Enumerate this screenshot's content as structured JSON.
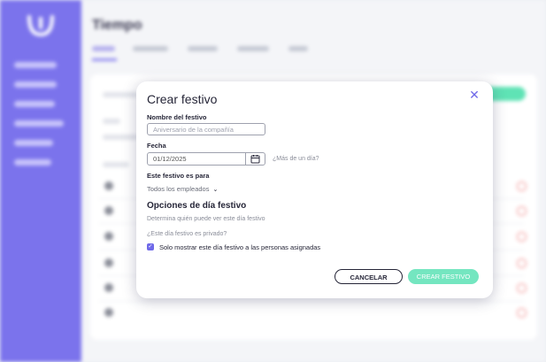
{
  "background": {
    "title": "Tiempo"
  },
  "modal": {
    "title": "Crear festivo",
    "close_icon": "close-icon",
    "name_label": "Nombre del festivo",
    "name_placeholder": "Aniversario de la compañía",
    "date_label": "Fecha",
    "date_value": "01/12/2025",
    "calendar_icon": "calendar-icon",
    "more_days_link": "¿Más de un día?",
    "for_label": "Este festivo es para",
    "for_value": "Todos los empleados",
    "options_title": "Opciones de día festivo",
    "options_help": "Determina quién puede ver este día festivo",
    "private_question": "¿Este día festivo es privado?",
    "private_checkbox_label": "Solo mostrar este día festivo a las personas asignadas",
    "private_checked": true,
    "cancel_button": "CANCELAR",
    "create_button": "CREAR FESTIVO"
  },
  "colors": {
    "accent": "#6f69e9",
    "sidebar": "#7b73ec",
    "create_button": "#74e6c0"
  }
}
